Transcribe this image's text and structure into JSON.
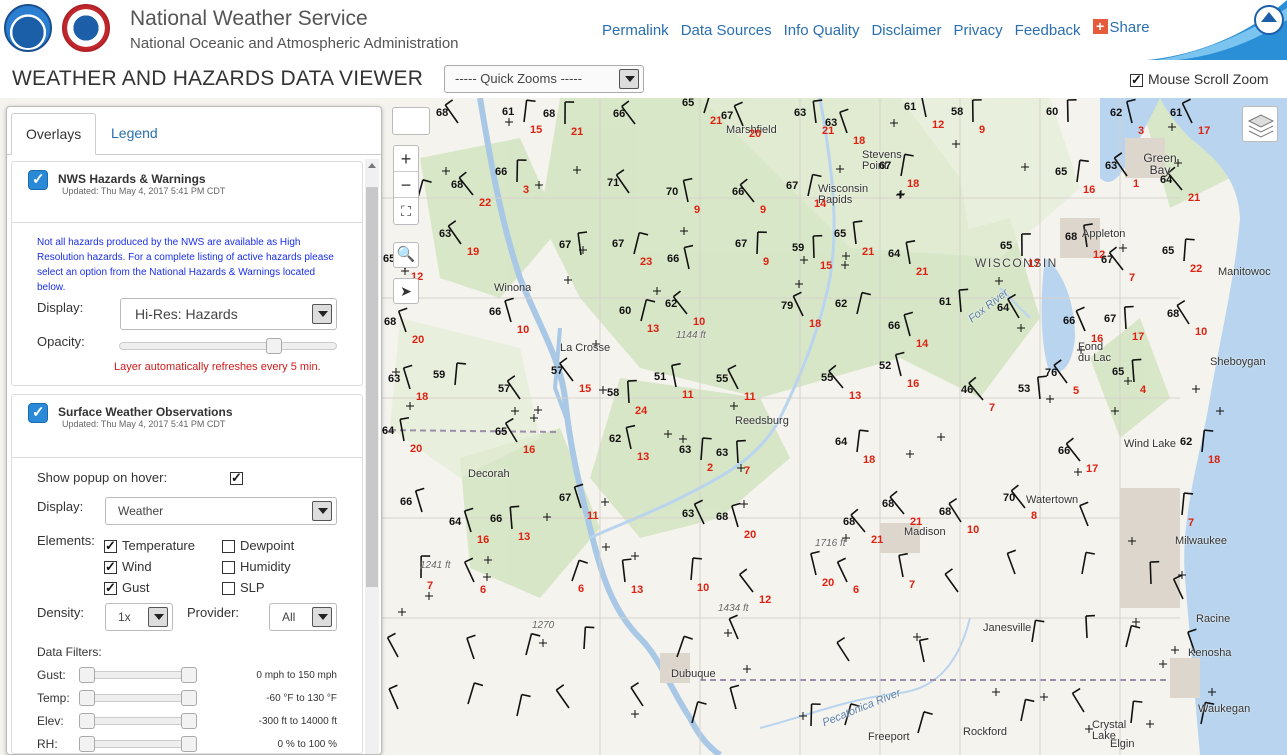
{
  "header": {
    "title": "National Weather Service",
    "subtitle": "National Oceanic and Atmospheric Administration",
    "nav": [
      "Permalink",
      "Data Sources",
      "Info Quality",
      "Disclaimer",
      "Privacy",
      "Feedback"
    ],
    "share": "Share"
  },
  "titlebar": {
    "title": "WEATHER AND HAZARDS DATA VIEWER",
    "quick_zooms": "----- Quick Zooms -----",
    "mouse_scroll_zoom": "Mouse Scroll Zoom",
    "mouse_scroll_zoom_checked": true
  },
  "panel": {
    "tabs": [
      "Overlays",
      "Legend"
    ],
    "active_tab": "Overlays",
    "hazards": {
      "title": "NWS Hazards & Warnings",
      "updated": "Updated: Thu May 4, 2017 5:41 PM CDT",
      "notice": "Not all hazards produced by the NWS are available as High Resolution hazards. For a complete listing of active hazards please select an option from the National Hazards & Warnings located below.",
      "display_label": "Display:",
      "display_value": "Hi-Res: Hazards",
      "opacity_label": "Opacity:",
      "opacity_value": 0.73,
      "refresh_note": "Layer automatically refreshes every 5 min."
    },
    "surface": {
      "title": "Surface Weather Observations",
      "updated": "Updated: Thu May 4, 2017 5:41 PM CDT",
      "popup_label": "Show popup on hover:",
      "popup_checked": true,
      "display_label": "Display:",
      "display_value": "Weather",
      "elements_label": "Elements:",
      "elements": [
        {
          "label": "Temperature",
          "checked": true
        },
        {
          "label": "Dewpoint",
          "checked": false
        },
        {
          "label": "Wind",
          "checked": true
        },
        {
          "label": "Humidity",
          "checked": false
        },
        {
          "label": "Gust",
          "checked": true
        },
        {
          "label": "SLP",
          "checked": false
        }
      ],
      "density_label": "Density:",
      "density_value": "1x",
      "provider_label": "Provider:",
      "provider_value": "All",
      "filters_label": "Data Filters:",
      "filters": [
        {
          "label": "Gust:",
          "value": "0 mph to 150 mph"
        },
        {
          "label": "Temp:",
          "value": "-60 °F to 130 °F"
        },
        {
          "label": "Elev:",
          "value": "-300 ft to 14000 ft"
        },
        {
          "label": "RH:",
          "value": "0 % to 100 %"
        }
      ]
    }
  },
  "map": {
    "places": [
      "Marshfield",
      "Stevens Point",
      "Wisconsin Rapids",
      "Green Bay",
      "Appleton",
      "Manitowoc",
      "WISCONSIN",
      "Fond du Lac",
      "Sheboygan",
      "Winona",
      "La Crosse",
      "Reedsburg",
      "Decorah",
      "Watertown",
      "Madison",
      "Milwaukee",
      "Janesville",
      "Racine",
      "Kenosha",
      "Dubuque",
      "Waukegan",
      "Crystal Lake",
      "Rockford",
      "Freeport",
      "Elgin",
      "Pecatonica River",
      "Fox River",
      "Wind Lake"
    ],
    "elevations": [
      "1144 ft",
      "1241 ft",
      "1270",
      "1434 ft",
      "1716 ft"
    ],
    "obs_temps": [
      "68",
      "61",
      "68",
      "66",
      "65",
      "67",
      "63",
      "63",
      "61",
      "58",
      "60",
      "62",
      "61",
      "57",
      "68",
      "66",
      "71",
      "70",
      "66",
      "67",
      "67",
      "65",
      "63",
      "64",
      "65",
      "63",
      "67",
      "67",
      "66",
      "67",
      "59",
      "65",
      "64",
      "65",
      "68",
      "67",
      "65",
      "68",
      "66",
      "60",
      "62",
      "79",
      "62",
      "66",
      "61",
      "64",
      "66",
      "67",
      "68",
      "63",
      "59",
      "57",
      "57",
      "58",
      "51",
      "55",
      "55",
      "52",
      "46",
      "53",
      "76",
      "65",
      "64",
      "65",
      "62",
      "63",
      "63",
      "64",
      "66",
      "62",
      "66",
      "64",
      "66",
      "67",
      "63",
      "68",
      "68",
      "68",
      "68",
      "70"
    ],
    "obs_gusts": [
      "15",
      "21",
      "21",
      "20",
      "21",
      "18",
      "12",
      "9",
      "3",
      "17",
      "22",
      "3",
      "9",
      "9",
      "14",
      "18",
      "16",
      "1",
      "21",
      "12",
      "19",
      "23",
      "9",
      "15",
      "21",
      "21",
      "17",
      "12",
      "7",
      "22",
      "20",
      "10",
      "13",
      "10",
      "18",
      "14",
      "16",
      "17",
      "10",
      "18",
      "15",
      "24",
      "11",
      "11",
      "13",
      "16",
      "7",
      "5",
      "4",
      "20",
      "16",
      "13",
      "2",
      "7",
      "18",
      "17",
      "18",
      "16",
      "13",
      "11",
      "20",
      "21",
      "21",
      "10",
      "8",
      "7",
      "7",
      "6",
      "6",
      "13",
      "10",
      "12",
      "20",
      "6",
      "7"
    ]
  }
}
